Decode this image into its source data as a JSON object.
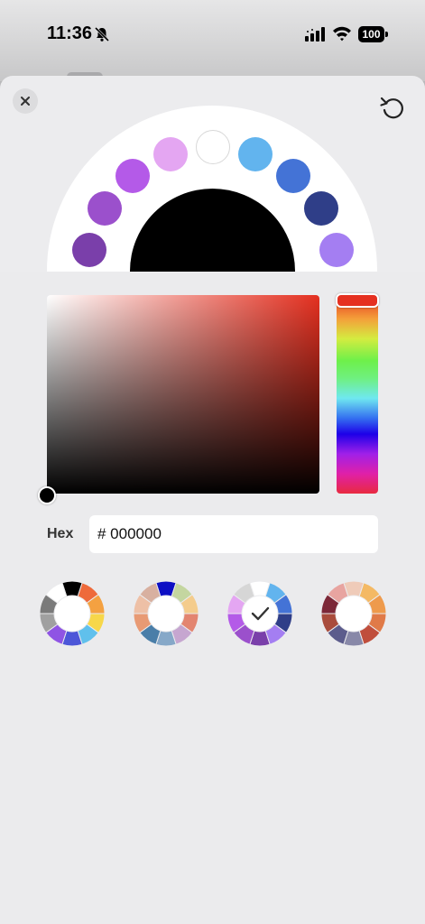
{
  "status_bar": {
    "time": "11:36",
    "icons": [
      "bell-slash-icon",
      "cellular-signal-icon",
      "wifi-icon",
      "battery-icon"
    ],
    "battery": "100"
  },
  "header": {
    "close_icon": "close-icon",
    "reset_icon": "reset-icon"
  },
  "wheel": {
    "center_color": "#000000",
    "swatches": [
      {
        "color": "#7a3faa"
      },
      {
        "color": "#9b50cc"
      },
      {
        "color": "#b45ae8"
      },
      {
        "color": "#e4a6f2"
      },
      {
        "color": "#ffffff"
      },
      {
        "color": "#62b4ee"
      },
      {
        "color": "#4473d6"
      },
      {
        "color": "#2f3e88"
      },
      {
        "color": "#a47ef2"
      }
    ]
  },
  "picker": {
    "hue_color": "#e53020",
    "hex_label": "Hex",
    "hex_value": "# 000000"
  },
  "palettes": [
    {
      "name": "palette-default",
      "selected": false,
      "colors": [
        "#000000",
        "#ee6a3b",
        "#f4a141",
        "#f7d74a",
        "#60c0ec",
        "#4c56d8",
        "#8f54e4",
        "#a0a0a0",
        "#7a7a7a",
        "#ffffff"
      ]
    },
    {
      "name": "palette-pastel",
      "selected": false,
      "colors": [
        "#0d0fc4",
        "#c4d6a0",
        "#f4cc8c",
        "#e38570",
        "#c6a6d0",
        "#86a8c8",
        "#4a7ea8",
        "#e89a74",
        "#eec0a6",
        "#d8b0a0"
      ]
    },
    {
      "name": "palette-purple-blue",
      "selected": true,
      "colors": [
        "#ffffff",
        "#62b4ee",
        "#4473d6",
        "#2f3e88",
        "#a47ef2",
        "#7a3faa",
        "#9b50cc",
        "#b45ae8",
        "#e4a6f2",
        "#d6d6d6"
      ]
    },
    {
      "name": "palette-earth",
      "selected": false,
      "colors": [
        "#efcbb9",
        "#f4b964",
        "#ee9a4c",
        "#e07a48",
        "#c04e3c",
        "#8888a8",
        "#5c5c8c",
        "#a94c3c",
        "#7c2838",
        "#e8a4a0"
      ]
    }
  ]
}
